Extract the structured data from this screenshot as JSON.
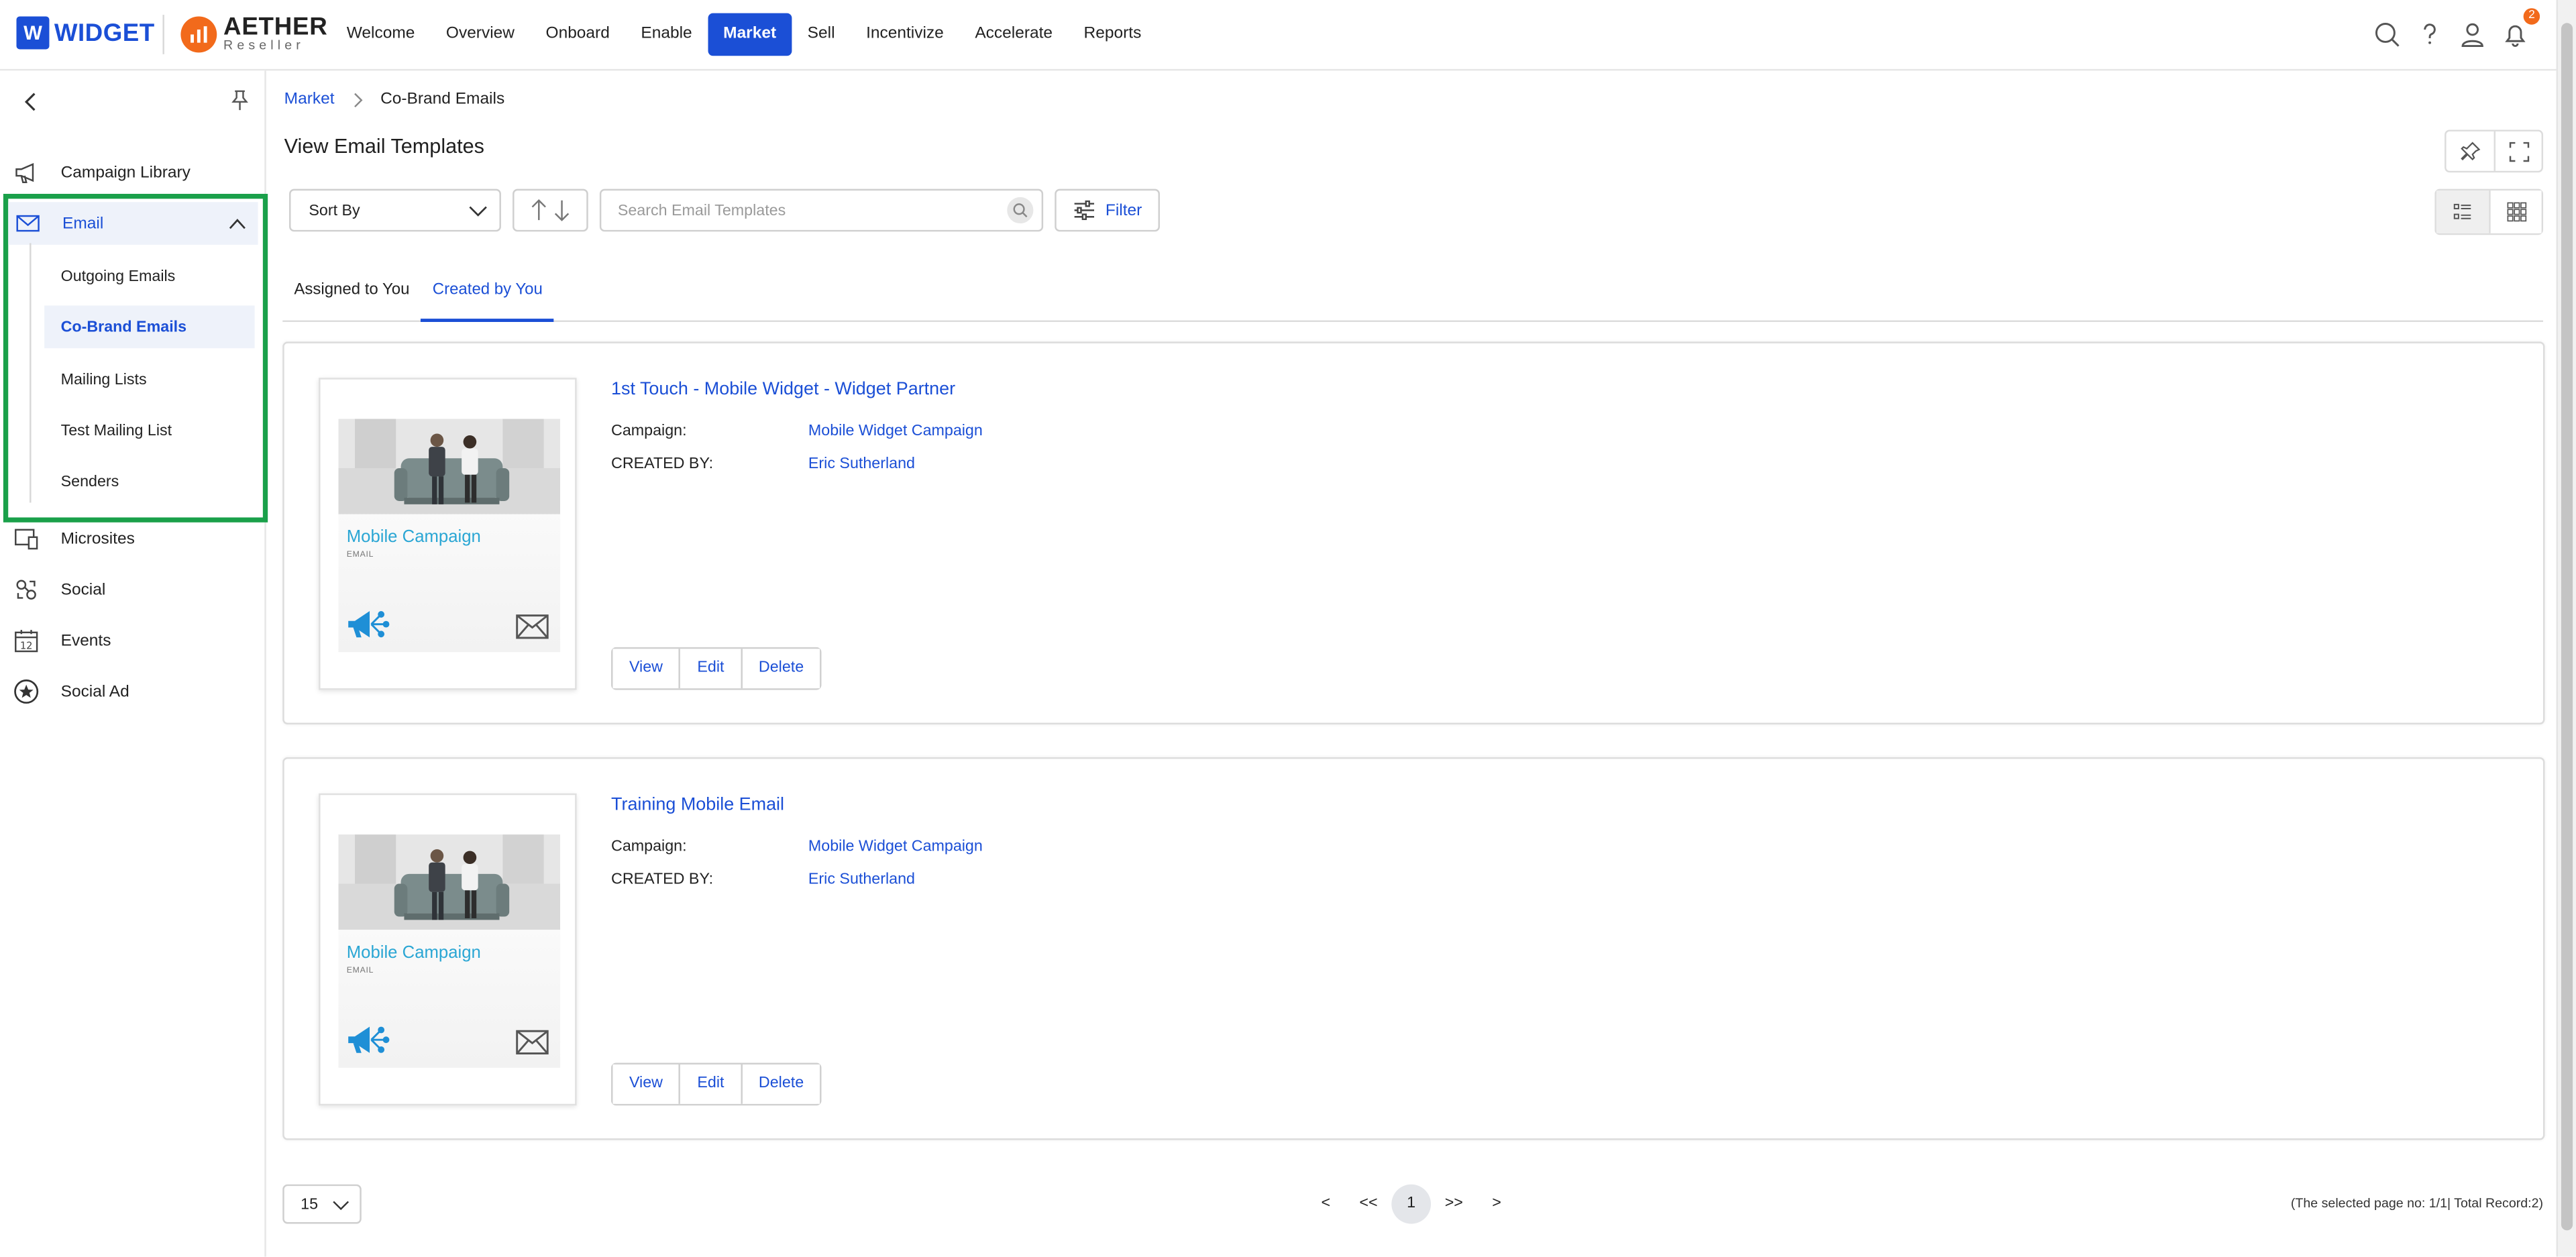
{
  "brand": {
    "widget_box": "W",
    "widget_name": "WIDGET",
    "aether_name": "AETHER",
    "aether_sub": "Reseller"
  },
  "nav": [
    "Welcome",
    "Overview",
    "Onboard",
    "Enable",
    "Market",
    "Sell",
    "Incentivize",
    "Accelerate",
    "Reports"
  ],
  "nav_active": "Market",
  "notifications_count": "2",
  "sidebar": {
    "items": [
      {
        "label": "Campaign Library",
        "icon": "megaphone-icon"
      },
      {
        "label": "Email",
        "icon": "envelope-icon"
      },
      {
        "label": "Microsites",
        "icon": "microsite-icon"
      },
      {
        "label": "Social",
        "icon": "social-icon"
      },
      {
        "label": "Events",
        "icon": "calendar-icon"
      },
      {
        "label": "Social Ad",
        "icon": "star-badge-icon"
      }
    ],
    "email_sub": [
      "Outgoing Emails",
      "Co-Brand Emails",
      "Mailing Lists",
      "Test Mailing List",
      "Senders"
    ],
    "email_sub_active": "Co-Brand Emails"
  },
  "breadcrumb": {
    "parent": "Market",
    "current": "Co-Brand Emails"
  },
  "page_title": "View Email Templates",
  "toolbar": {
    "sort_label": "Sort By",
    "search_placeholder": "Search Email Templates",
    "filter_label": "Filter"
  },
  "tabs": [
    "Assigned to You",
    "Created by You"
  ],
  "active_tab": "Created by You",
  "templates": [
    {
      "title": "1st Touch - Mobile Widget - Widget Partner",
      "thumb_title": "Mobile Campaign",
      "thumb_sub": "EMAIL",
      "campaign_label": "Campaign:",
      "campaign": "Mobile Widget Campaign",
      "created_label": "CREATED BY:",
      "created_by": "Eric Sutherland",
      "actions": [
        "View",
        "Edit",
        "Delete"
      ]
    },
    {
      "title": "Training Mobile Email",
      "thumb_title": "Mobile Campaign",
      "thumb_sub": "EMAIL",
      "campaign_label": "Campaign:",
      "campaign": "Mobile Widget Campaign",
      "created_label": "CREATED BY:",
      "created_by": "Eric Sutherland",
      "actions": [
        "View",
        "Edit",
        "Delete"
      ]
    }
  ],
  "pagination": {
    "page_size": "15",
    "controls": [
      "<",
      "<<",
      "1",
      ">>",
      ">"
    ],
    "current_page": "1",
    "info": "(The selected page no: 1/1| Total Record:2)"
  },
  "colors": {
    "accent": "#1b4fd6",
    "brand_orange": "#f26a1b",
    "highlight_box": "#1aa04a",
    "thumb_title": "#2aa6d4"
  }
}
